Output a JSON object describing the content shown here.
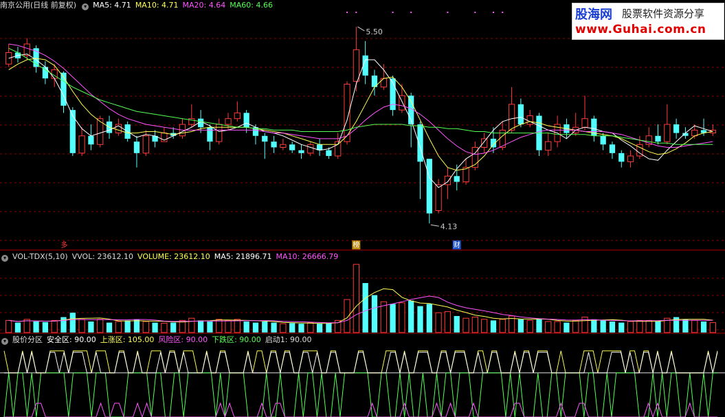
{
  "price_panel": {
    "stock_title": "南京公用",
    "period_label": "(日线 前复权)",
    "ma5": "MA5: 4.71",
    "ma10": "MA10: 4.71",
    "ma20": "MA20: 4.64",
    "ma60": "MA60: 4.66",
    "high_label": "5.50",
    "low_label": "4.13",
    "marker_left": "多",
    "marker_bang": "榜",
    "marker_cai": "财"
  },
  "vol_panel": {
    "name": "VOL-TDX(5,10)",
    "vvol": "VVOL: 23612.10",
    "volume": "VOLUME: 23612.10",
    "ma5": "MA5: 21896.71",
    "ma10": "MA10: 26666.79"
  },
  "zone_panel": {
    "name": "股价分区",
    "safe": "安全区: 90.00",
    "rise": "上涨区: 105.00",
    "risk": "风险区: 90.00",
    "fall": "下跌区: 90.00",
    "start": "启动1: 90.00"
  },
  "watermark": {
    "brand": "股海网",
    "slogan": "股票软件资源分享",
    "url": "www.Guhai.com.cn"
  },
  "colors": {
    "up": "#ff3c3c",
    "down": "#54ffff",
    "ma5": "#ffffff",
    "ma10": "#ffff55",
    "ma20": "#ff55ff",
    "ma60": "#55ff55",
    "grid": "#8b0000"
  },
  "chart_data": {
    "type": "candlestick",
    "price_ylim": [
      4.05,
      5.6
    ],
    "price_series": [
      {
        "name": "MA5",
        "values": [
          5.28,
          5.3,
          5.31,
          5.27,
          5.22,
          5.14,
          5.02,
          4.88,
          4.79,
          4.74,
          4.76,
          4.78,
          4.81,
          4.77,
          4.73,
          4.75,
          4.74,
          4.71,
          4.74,
          4.77,
          4.8,
          4.84,
          4.81,
          4.77,
          4.78,
          4.8,
          4.83,
          4.8,
          4.77,
          4.76,
          4.74,
          4.71,
          4.68,
          4.66,
          4.64,
          4.65,
          4.68,
          4.85,
          5.1,
          5.27,
          5.27,
          5.2,
          5.11,
          4.98,
          4.85,
          4.66,
          4.45,
          4.38,
          4.42,
          4.51,
          4.58,
          4.62,
          4.7,
          4.78,
          4.84,
          4.86,
          4.87,
          4.84,
          4.81,
          4.78,
          4.76,
          4.72,
          4.78,
          4.8,
          4.79,
          4.77,
          4.76,
          4.71,
          4.67,
          4.62,
          4.58,
          4.57,
          4.64,
          4.7,
          4.76,
          4.81,
          4.79,
          4.77
        ]
      },
      {
        "name": "MA10",
        "values": [
          5.2,
          5.24,
          5.27,
          5.28,
          5.27,
          5.23,
          5.15,
          5.05,
          4.96,
          4.89,
          4.84,
          4.8,
          4.78,
          4.76,
          4.76,
          4.77,
          4.77,
          4.76,
          4.75,
          4.76,
          4.77,
          4.79,
          4.8,
          4.8,
          4.8,
          4.8,
          4.8,
          4.79,
          4.78,
          4.77,
          4.76,
          4.74,
          4.72,
          4.7,
          4.68,
          4.68,
          4.68,
          4.74,
          4.84,
          4.96,
          5.08,
          5.14,
          5.15,
          5.08,
          4.98,
          4.85,
          4.72,
          4.6,
          4.52,
          4.5,
          4.51,
          4.54,
          4.6,
          4.68,
          4.74,
          4.79,
          4.82,
          4.84,
          4.83,
          4.81,
          4.8,
          4.79,
          4.78,
          4.77,
          4.76,
          4.75,
          4.74,
          4.72,
          4.69,
          4.66,
          4.63,
          4.61,
          4.62,
          4.65,
          4.69,
          4.74,
          4.76,
          4.77
        ]
      },
      {
        "name": "MA20",
        "values": [
          5.38,
          5.37,
          5.35,
          5.33,
          5.3,
          5.26,
          5.21,
          5.15,
          5.09,
          5.03,
          4.98,
          4.93,
          4.89,
          4.86,
          4.84,
          4.82,
          4.81,
          4.8,
          4.79,
          4.78,
          4.78,
          4.78,
          4.78,
          4.78,
          4.78,
          4.78,
          4.78,
          4.78,
          4.77,
          4.76,
          4.76,
          4.75,
          4.74,
          4.73,
          4.72,
          4.72,
          4.72,
          4.74,
          4.79,
          4.85,
          4.9,
          4.94,
          4.96,
          4.95,
          4.93,
          4.89,
          4.84,
          4.78,
          4.72,
          4.67,
          4.63,
          4.61,
          4.62,
          4.64,
          4.67,
          4.7,
          4.73,
          4.75,
          4.77,
          4.78,
          4.78,
          4.78,
          4.78,
          4.77,
          4.77,
          4.77,
          4.76,
          4.75,
          4.73,
          4.71,
          4.69,
          4.67,
          4.66,
          4.66,
          4.67,
          4.68,
          4.69,
          4.7
        ]
      },
      {
        "name": "MA60",
        "values": [
          5.35,
          5.32,
          5.28,
          5.24,
          5.2,
          5.16,
          5.12,
          5.08,
          5.05,
          5.02,
          4.99,
          4.97,
          4.95,
          4.93,
          4.91,
          4.9,
          4.89,
          4.88,
          4.87,
          4.86,
          4.85,
          4.84,
          4.83,
          4.82,
          4.81,
          4.8,
          4.8,
          4.79,
          4.79,
          4.78,
          4.78,
          4.78,
          4.77,
          4.77,
          4.77,
          4.77,
          4.77,
          4.78,
          4.8,
          4.81,
          4.82,
          4.82,
          4.82,
          4.82,
          4.81,
          4.81,
          4.8,
          4.8,
          4.79,
          4.79,
          4.78,
          4.77,
          4.77,
          4.76,
          4.76,
          4.76,
          4.76,
          4.76,
          4.76,
          4.76,
          4.75,
          4.75,
          4.75,
          4.75,
          4.74,
          4.74,
          4.74,
          4.73,
          4.72,
          4.71,
          4.7,
          4.69,
          4.69,
          4.68,
          4.68,
          4.68,
          4.68,
          4.68
        ]
      }
    ],
    "candles": [
      [
        5.24,
        5.32,
        5.38,
        5.22
      ],
      [
        5.32,
        5.28,
        5.36,
        5.25
      ],
      [
        5.3,
        5.38,
        5.42,
        5.27
      ],
      [
        5.35,
        5.22,
        5.37,
        5.18
      ],
      [
        5.22,
        5.14,
        5.26,
        5.1
      ],
      [
        5.14,
        5.2,
        5.24,
        5.08
      ],
      [
        5.18,
        4.95,
        5.19,
        4.9
      ],
      [
        4.92,
        4.62,
        4.94,
        4.6
      ],
      [
        4.62,
        4.74,
        4.8,
        4.6
      ],
      [
        4.74,
        4.68,
        4.82,
        4.64
      ],
      [
        4.68,
        4.86,
        4.88,
        4.66
      ],
      [
        4.84,
        4.76,
        4.88,
        4.72
      ],
      [
        4.76,
        4.82,
        4.86,
        4.74
      ],
      [
        4.82,
        4.72,
        4.84,
        4.7
      ],
      [
        4.7,
        4.62,
        4.74,
        4.52
      ],
      [
        4.62,
        4.74,
        4.78,
        4.6
      ],
      [
        4.74,
        4.7,
        4.78,
        4.66
      ],
      [
        4.7,
        4.76,
        4.8,
        4.7
      ],
      [
        4.76,
        4.74,
        4.8,
        4.72
      ],
      [
        4.74,
        4.82,
        4.86,
        4.72
      ],
      [
        4.82,
        4.86,
        4.96,
        4.8
      ],
      [
        4.86,
        4.8,
        4.92,
        4.76
      ],
      [
        4.8,
        4.7,
        4.82,
        4.64
      ],
      [
        4.7,
        4.82,
        4.86,
        4.68
      ],
      [
        4.82,
        4.86,
        4.9,
        4.78
      ],
      [
        4.86,
        4.9,
        4.98,
        4.84
      ],
      [
        4.9,
        4.8,
        4.92,
        4.76
      ],
      [
        4.8,
        4.74,
        4.82,
        4.68
      ],
      [
        4.74,
        4.7,
        4.76,
        4.58
      ],
      [
        4.7,
        4.66,
        4.74,
        4.62
      ],
      [
        4.66,
        4.68,
        4.72,
        4.64
      ],
      [
        4.68,
        4.64,
        4.7,
        4.62
      ],
      [
        4.64,
        4.62,
        4.68,
        4.58
      ],
      [
        4.62,
        4.68,
        4.7,
        4.6
      ],
      [
        4.68,
        4.64,
        4.72,
        4.6
      ],
      [
        4.64,
        4.6,
        4.66,
        4.58
      ],
      [
        4.6,
        4.7,
        4.76,
        4.58
      ],
      [
        4.7,
        5.1,
        5.12,
        4.68
      ],
      [
        5.12,
        5.34,
        5.5,
        5.05
      ],
      [
        5.3,
        5.16,
        5.4,
        5.1
      ],
      [
        5.16,
        5.08,
        5.2,
        5.02
      ],
      [
        5.08,
        5.14,
        5.24,
        5.06
      ],
      [
        5.14,
        4.92,
        5.16,
        4.88
      ],
      [
        4.92,
        5.02,
        5.1,
        4.9
      ],
      [
        5.02,
        4.82,
        5.04,
        4.66
      ],
      [
        4.82,
        4.56,
        4.84,
        4.3
      ],
      [
        4.58,
        4.2,
        4.58,
        4.13
      ],
      [
        4.22,
        4.4,
        4.44,
        4.2
      ],
      [
        4.4,
        4.46,
        4.52,
        4.3
      ],
      [
        4.46,
        4.42,
        4.54,
        4.36
      ],
      [
        4.42,
        4.52,
        4.58,
        4.4
      ],
      [
        4.52,
        4.66,
        4.7,
        4.5
      ],
      [
        4.66,
        4.72,
        4.76,
        4.62
      ],
      [
        4.72,
        4.66,
        4.8,
        4.62
      ],
      [
        4.66,
        4.78,
        4.84,
        4.64
      ],
      [
        4.78,
        4.96,
        5.08,
        4.76
      ],
      [
        4.96,
        4.82,
        5.0,
        4.8
      ],
      [
        4.82,
        4.88,
        4.92,
        4.8
      ],
      [
        4.88,
        4.64,
        4.9,
        4.6
      ],
      [
        4.64,
        4.7,
        4.76,
        4.6
      ],
      [
        4.7,
        4.82,
        4.88,
        4.66
      ],
      [
        4.82,
        4.76,
        4.86,
        4.72
      ],
      [
        4.76,
        4.8,
        4.9,
        4.74
      ],
      [
        4.8,
        4.86,
        5.02,
        4.78
      ],
      [
        4.86,
        4.74,
        4.88,
        4.7
      ],
      [
        4.74,
        4.68,
        4.76,
        4.64
      ],
      [
        4.68,
        4.62,
        4.7,
        4.58
      ],
      [
        4.62,
        4.56,
        4.64,
        4.52
      ],
      [
        4.56,
        4.6,
        4.64,
        4.52
      ],
      [
        4.6,
        4.68,
        4.74,
        4.58
      ],
      [
        4.68,
        4.74,
        4.8,
        4.66
      ],
      [
        4.74,
        4.7,
        4.82,
        4.68
      ],
      [
        4.7,
        4.82,
        4.96,
        4.68
      ],
      [
        4.82,
        4.76,
        4.86,
        4.72
      ],
      [
        4.76,
        4.74,
        4.8,
        4.72
      ],
      [
        4.74,
        4.78,
        4.82,
        4.72
      ],
      [
        4.78,
        4.76,
        4.86,
        4.74
      ],
      [
        4.76,
        4.78,
        4.82,
        4.74
      ]
    ],
    "volumes": [
      11000,
      9000,
      12000,
      10000,
      9500,
      11000,
      14000,
      18000,
      12000,
      10000,
      12000,
      9000,
      10000,
      11000,
      12000,
      10000,
      9000,
      8500,
      9000,
      11000,
      13000,
      11000,
      10000,
      12000,
      11000,
      12000,
      10000,
      9000,
      10000,
      9000,
      8000,
      8500,
      8000,
      9000,
      8000,
      8500,
      11000,
      30000,
      62000,
      45000,
      34000,
      28000,
      26000,
      27000,
      29000,
      24000,
      26000,
      18000,
      19000,
      15000,
      13000,
      14000,
      12000,
      11000,
      12000,
      15000,
      12000,
      11000,
      12000,
      10000,
      10000,
      9000,
      11000,
      14000,
      12000,
      11000,
      10000,
      9000,
      10000,
      11000,
      11000,
      10000,
      13000,
      14000,
      12000,
      11000,
      10000,
      9000
    ],
    "vol_ylim": [
      0,
      65000
    ],
    "zone_levels": {
      "safe": 90,
      "rise": 105,
      "risk": 90,
      "fall": 90,
      "start1": 90
    }
  }
}
